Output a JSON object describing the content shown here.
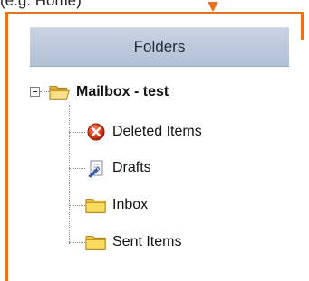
{
  "caption": {
    "text": "(e.g. Home)"
  },
  "accent_color": "#e8731e",
  "folders_panel": {
    "title": "Folders"
  },
  "tree": {
    "root": {
      "label": "Mailbox - test",
      "icon": "open-folder-icon",
      "expanded": true
    },
    "children": [
      {
        "label": "Deleted Items",
        "icon": "deleted-items-icon"
      },
      {
        "label": "Drafts",
        "icon": "drafts-icon"
      },
      {
        "label": "Inbox",
        "icon": "folder-icon"
      },
      {
        "label": "Sent Items",
        "icon": "folder-icon"
      }
    ]
  }
}
